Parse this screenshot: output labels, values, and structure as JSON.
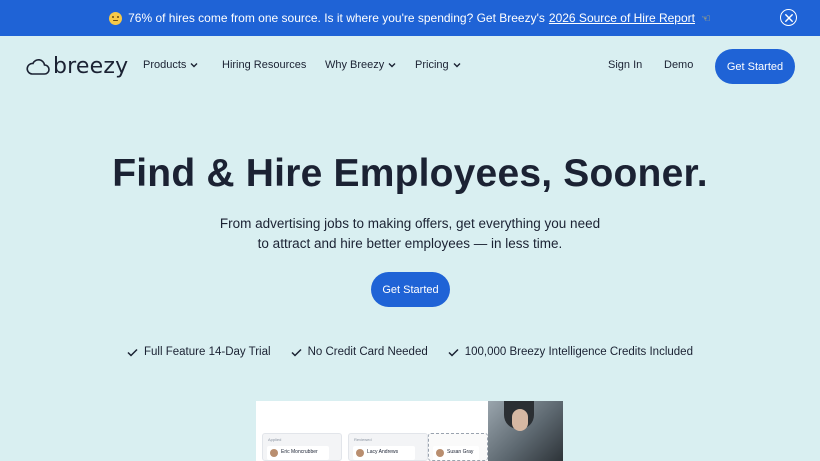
{
  "banner": {
    "text": "76% of hires come from one source. Is it where you're spending? Get Breezy's",
    "link": "2026 Source of Hire Report",
    "emoji_icon": "smiling-face-icon",
    "pointer_icon": "hand-pointing-left-icon",
    "background": "#1f63d6"
  },
  "brand": {
    "name": "breezy"
  },
  "nav": {
    "products": "Products",
    "resources": "Hiring Resources",
    "why": "Why Breezy",
    "pricing": "Pricing",
    "sign_in": "Sign In",
    "demo": "Demo",
    "cta": "Get Started"
  },
  "hero": {
    "title": "Find & Hire Employees, Sooner.",
    "subtitle_line1": "From advertising jobs to making offers, get everything you need",
    "subtitle_line2": "to attract and hire better employees — in less time.",
    "cta": "Get Started"
  },
  "features": [
    "Full Feature 14-Day Trial",
    "No Credit Card Needed",
    "100,000 Breezy Intelligence Credits Included"
  ],
  "preview": {
    "col1_header": "Applied",
    "col1_candidate": "Eric Moncrubber",
    "col2_header": "Reviewed",
    "col2_candidate": "Lacy Andrews",
    "col3_candidate": "Susan Gray"
  },
  "colors": {
    "accent": "#1f63d6",
    "page_bg": "#d9eff1",
    "text": "#1b2233"
  }
}
